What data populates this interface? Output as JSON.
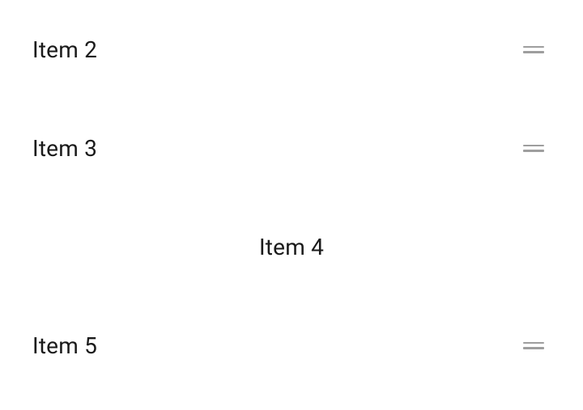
{
  "list": {
    "items": [
      {
        "label": "Item 2",
        "detached": false
      },
      {
        "label": "Item 3",
        "detached": false
      },
      {
        "label": "Item 4",
        "detached": true
      },
      {
        "label": "Item 5",
        "detached": false
      }
    ]
  }
}
